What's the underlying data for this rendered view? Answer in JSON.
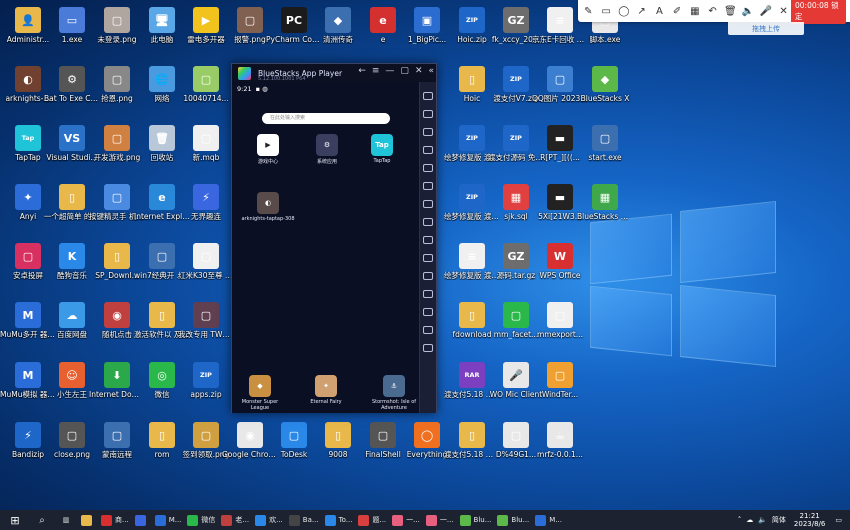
{
  "toolbar": {
    "recording": "00:00:08 锁定",
    "upload": "拖拽上传"
  },
  "bluestacks": {
    "title": "BlueStacks App Player",
    "version": "5.12.100.1001 P64",
    "time": "9:21",
    "search_placeholder": "在此处输入搜索",
    "apps": [
      {
        "label": "游戏中心",
        "color": "#ffffff"
      },
      {
        "label": "系统应用",
        "color": "#3a3f60"
      },
      {
        "label": "TapTap",
        "color": "#1fc4d8"
      },
      {
        "label": "arknights-taptap-308",
        "color": "#5a4b4b"
      }
    ],
    "dock": [
      "Monster Super League",
      "Eternal Fairy",
      "Stormshot: Isle of Adventure"
    ]
  },
  "desktop_icons": [
    {
      "label": "Administr...",
      "color": "#e8b84a",
      "glyph": "👤"
    },
    {
      "label": "1.exe",
      "color": "#4a7bd8",
      "glyph": "▭"
    },
    {
      "label": "未登录.png",
      "color": "#b0a6a0",
      "glyph": "▢"
    },
    {
      "label": "此电脑",
      "color": "#5aa7e8",
      "glyph": "🖥"
    },
    {
      "label": "雷电多开器",
      "color": "#f2c31c",
      "glyph": "▶"
    },
    {
      "label": "报警.png",
      "color": "#806050",
      "glyph": "▢"
    },
    {
      "label": "PyCharm Communi...",
      "color": "#1b1b1b",
      "glyph": "PC"
    },
    {
      "label": "清洲传奇",
      "color": "#3c6fb0",
      "glyph": "◆"
    },
    {
      "label": "e",
      "color": "#d43030",
      "glyph": "e"
    },
    {
      "label": "1_BigPic...",
      "color": "#2a6cd0",
      "glyph": "▣"
    },
    {
      "label": "Hoic.zip",
      "color": "#1e66c8",
      "glyph": "ZIP"
    },
    {
      "label": "fk_xccy_20...",
      "color": "#6d6d6d",
      "glyph": "GZ"
    },
    {
      "label": "京东E卡回收 渠道.txt",
      "color": "#f0f0f0",
      "glyph": "≡"
    },
    {
      "label": "脚本.exe",
      "color": "#e8e8e8",
      "glyph": "▢"
    },
    {
      "label": "arknights-...",
      "color": "#704030",
      "glyph": "◐"
    },
    {
      "label": "Bat To Exe Converter",
      "color": "#555",
      "glyph": "⚙"
    },
    {
      "label": "抢恩.png",
      "color": "#888",
      "glyph": "▢"
    },
    {
      "label": "网络",
      "color": "#4a9ae0",
      "glyph": "🌐"
    },
    {
      "label": "10040714...",
      "color": "#9c6",
      "glyph": "▢"
    },
    {
      "label": "Hoic",
      "color": "#e8b84a",
      "glyph": "▯"
    },
    {
      "label": "渡支付V7.zip",
      "color": "#1e66c8",
      "glyph": "ZIP"
    },
    {
      "label": "QQ图片 20230803...",
      "color": "#3c7fd0",
      "glyph": "▢"
    },
    {
      "label": "BlueStacks X",
      "color": "#5db84a",
      "glyph": "◆"
    },
    {
      "label": "TapTap",
      "color": "#1fc4d8",
      "glyph": "Tap"
    },
    {
      "label": "Visual Studi...",
      "color": "#2a72c8",
      "glyph": "VS"
    },
    {
      "label": "开发游戏.png",
      "color": "#d08040",
      "glyph": "▢"
    },
    {
      "label": "回收站",
      "color": "#b9c8d8",
      "glyph": "🗑"
    },
    {
      "label": "新.mqb",
      "color": "#f0f0f0",
      "glyph": "▢"
    },
    {
      "label": "绘梦修复版 渡支付5...",
      "color": "#1e66c8",
      "glyph": "ZIP"
    },
    {
      "label": "渡支付源码 免费开源...",
      "color": "#1e66c8",
      "glyph": "ZIP"
    },
    {
      "label": "R[PT_][((...",
      "color": "#222",
      "glyph": "▬"
    },
    {
      "label": "start.exe",
      "color": "#3c6fb0",
      "glyph": "▢"
    },
    {
      "label": "Anyi",
      "color": "#2c6cd8",
      "glyph": "✦"
    },
    {
      "label": "一个超简单 的自动加...",
      "color": "#e8b84a",
      "glyph": "▯"
    },
    {
      "label": "按键精灵手 机助手",
      "color": "#4a8ae0",
      "glyph": "▢"
    },
    {
      "label": "Internet Explorer",
      "color": "#2a88d8",
      "glyph": "e"
    },
    {
      "label": "无界趣连",
      "color": "#3a66e0",
      "glyph": "⚡"
    },
    {
      "label": "绘梦修复版 渡支付5...",
      "color": "#1e66c8",
      "glyph": "ZIP"
    },
    {
      "label": "sjk.sql",
      "color": "#e04040",
      "glyph": "▦"
    },
    {
      "label": "5Xi[21W3...",
      "color": "#222",
      "glyph": "▬"
    },
    {
      "label": "BlueStacks 多开器...",
      "color": "#3fa84a",
      "glyph": "▦"
    },
    {
      "label": "安卓投屏",
      "color": "#d83060",
      "glyph": "▢"
    },
    {
      "label": "酷狗音乐",
      "color": "#2a88e8",
      "glyph": "K"
    },
    {
      "label": "SP_Downl...",
      "color": "#e8b84a",
      "glyph": "▯"
    },
    {
      "label": "win7经典开 始菜单工具",
      "color": "#3c6fb0",
      "glyph": "▢"
    },
    {
      "label": "红米K30至尊 版-11.0...",
      "color": "#f0f0f0",
      "glyph": "▢"
    },
    {
      "label": "免",
      "color": "#e8b84a",
      "glyph": "▯"
    },
    {
      "label": "绘梦修复版 渡支付5.1...",
      "color": "#f0f0f0",
      "glyph": "≡"
    },
    {
      "label": "源码.tar.gz",
      "color": "#6d6d6d",
      "glyph": "GZ"
    },
    {
      "label": "WPS Office",
      "color": "#d83030",
      "glyph": "W"
    },
    {
      "label": "MuMu多开 器12",
      "color": "#2a6cd8",
      "glyph": "M"
    },
    {
      "label": "百度网盘",
      "color": "#3a9ae8",
      "glyph": "☁"
    },
    {
      "label": "随机点击",
      "color": "#c04040",
      "glyph": "◉"
    },
    {
      "label": "激活软件以 及起动",
      "color": "#e8b84a",
      "glyph": "▯"
    },
    {
      "label": "我改专用 TWRPRec...",
      "color": "#604050",
      "glyph": "▢"
    },
    {
      "label": "20",
      "color": "#e8b84a",
      "glyph": "▯"
    },
    {
      "label": "fdownload",
      "color": "#e8b84a",
      "glyph": "▯"
    },
    {
      "label": "mm_facet...",
      "color": "#2ab84a",
      "glyph": "▢"
    },
    {
      "label": "mmexport...",
      "color": "#f0f0f0",
      "glyph": "▢"
    },
    {
      "label": "MuMu模拟 器12",
      "color": "#2a6cd8",
      "glyph": "M"
    },
    {
      "label": "小生左王",
      "color": "#e86030",
      "glyph": "☺"
    },
    {
      "label": "Internet Downlo...",
      "color": "#2aa84a",
      "glyph": "⬇"
    },
    {
      "label": "微信",
      "color": "#2ab84a",
      "glyph": "◎"
    },
    {
      "label": "apps.zip",
      "color": "#1e66c8",
      "glyph": "ZIP"
    },
    {
      "label": "渡支付5.18 最新版仿...",
      "color": "#7b3fc0",
      "glyph": "RAR"
    },
    {
      "label": "WO Mic Client",
      "color": "#e8e8e8",
      "glyph": "🎤"
    },
    {
      "label": "WindTer...",
      "color": "#f0a030",
      "glyph": "▢"
    },
    {
      "label": "Bandizip",
      "color": "#1e66c8",
      "glyph": "⚡"
    },
    {
      "label": "close.png",
      "color": "#555",
      "glyph": "▢"
    },
    {
      "label": "蒙南远程",
      "color": "#3c6fb0",
      "glyph": "▢"
    },
    {
      "label": "rom",
      "color": "#e8b84a",
      "glyph": "▯"
    },
    {
      "label": "签到领取.png",
      "color": "#d0a040",
      "glyph": "▢"
    },
    {
      "label": "Google Chrome",
      "color": "#e8e8e8",
      "glyph": "◉"
    },
    {
      "label": "ToDesk",
      "color": "#2a88e8",
      "glyph": "▢"
    },
    {
      "label": "9008",
      "color": "#e8b84a",
      "glyph": "▯"
    },
    {
      "label": "FinalShell",
      "color": "#555",
      "glyph": "▢"
    },
    {
      "label": "Everything",
      "color": "#f07020",
      "glyph": "◯"
    },
    {
      "label": "渡支付5.18 最新版仿...",
      "color": "#e8b84a",
      "glyph": "▯"
    },
    {
      "label": "D%49G1...",
      "color": "#e8e8e8",
      "glyph": "▢"
    },
    {
      "label": "mrfz-0.0.1...",
      "color": "#e8e8e8",
      "glyph": "☕"
    }
  ],
  "taskbar": {
    "items": [
      {
        "label": "",
        "color": "#e8b84a"
      },
      {
        "label": "商...",
        "color": "#d83030"
      },
      {
        "label": "",
        "color": "#3a66e0"
      },
      {
        "label": "M...",
        "color": "#2a6cd8"
      },
      {
        "label": "微信",
        "color": "#2ab84a"
      },
      {
        "label": "老...",
        "color": "#c04040"
      },
      {
        "label": "欢...",
        "color": "#2a88e8"
      },
      {
        "label": "Ba...",
        "color": "#444"
      },
      {
        "label": "To...",
        "color": "#2a88e8"
      },
      {
        "label": "题...",
        "color": "#d84040"
      },
      {
        "label": "一...",
        "color": "#e86080"
      },
      {
        "label": "一...",
        "color": "#e86080"
      },
      {
        "label": "Blu...",
        "color": "#5db84a"
      },
      {
        "label": "Blu...",
        "color": "#5db84a"
      },
      {
        "label": "M...",
        "color": "#2a6cd8"
      }
    ],
    "ime": "简体",
    "time": "21:21",
    "date": "2023/8/6"
  }
}
